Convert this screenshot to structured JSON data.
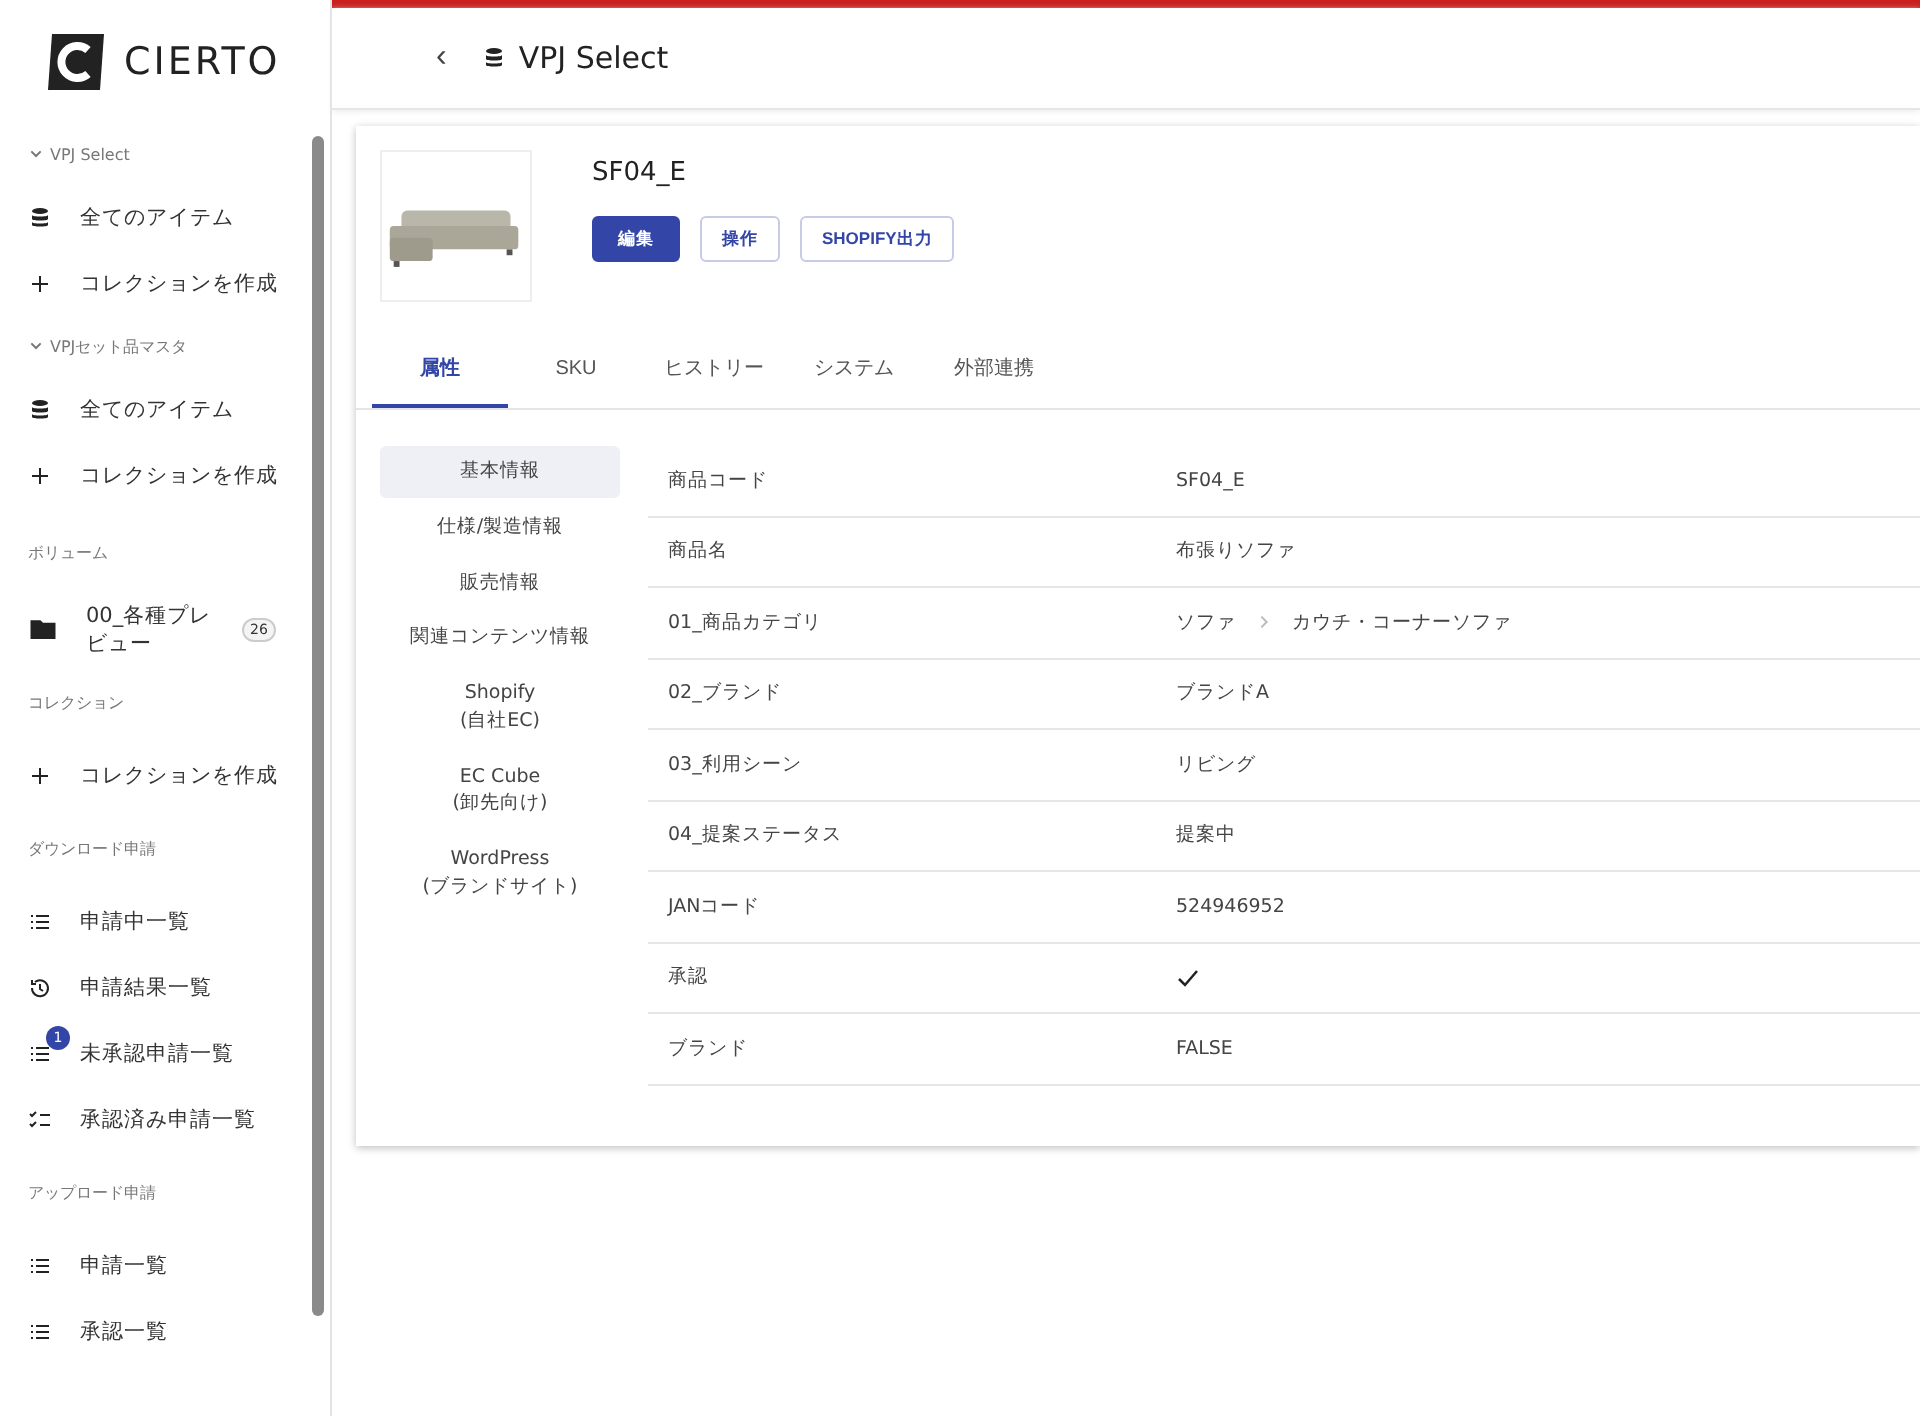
{
  "logo": {
    "text": "CIERTO"
  },
  "sidebar": {
    "groups": [
      {
        "heading": "VPJ Select",
        "collapsible": true,
        "items": [
          {
            "label": "全てのアイテム",
            "kind": "database"
          },
          {
            "label": "コレクションを作成",
            "kind": "plus"
          }
        ]
      },
      {
        "heading": "VPJセット品マスタ",
        "collapsible": true,
        "items": [
          {
            "label": "全てのアイテム",
            "kind": "database"
          },
          {
            "label": "コレクションを作成",
            "kind": "plus"
          }
        ]
      },
      {
        "heading": "ボリューム",
        "collapsible": false,
        "items": [
          {
            "label": "00_各種プレビュー",
            "kind": "folder",
            "count": "26"
          }
        ]
      },
      {
        "heading": "コレクション",
        "collapsible": false,
        "items": [
          {
            "label": "コレクションを作成",
            "kind": "plus"
          }
        ]
      },
      {
        "heading": "ダウンロード申請",
        "collapsible": false,
        "items": [
          {
            "label": "申請中一覧",
            "kind": "list"
          },
          {
            "label": "申請結果一覧",
            "kind": "history"
          },
          {
            "label": "未承認申請一覧",
            "kind": "list",
            "badge": "1"
          },
          {
            "label": "承認済み申請一覧",
            "kind": "checklist"
          }
        ]
      },
      {
        "heading": "アップロード申請",
        "collapsible": false,
        "items": [
          {
            "label": "申請一覧",
            "kind": "list"
          },
          {
            "label": "承認一覧",
            "kind": "list"
          }
        ]
      }
    ]
  },
  "header": {
    "back": "‹",
    "title": "VPJ Select"
  },
  "product": {
    "kind": "picture",
    "code": "SF04_E",
    "buttons": [
      {
        "label": "編集",
        "kind": "primary"
      },
      {
        "label": "操作",
        "kind": "outlined"
      },
      {
        "label": "SHOPIFY出力",
        "kind": "outlined"
      }
    ]
  },
  "tabs": [
    {
      "label": "属性",
      "selected": true
    },
    {
      "label": "SKU",
      "selected": false
    },
    {
      "label": "ヒストリー",
      "selected": false
    },
    {
      "label": "システム",
      "selected": false
    },
    {
      "label": "外部連携",
      "selected": false
    }
  ],
  "sections": [
    {
      "label": "基本情報",
      "selected": true
    },
    {
      "label": "仕様/製造情報",
      "selected": false
    },
    {
      "label": "販売情報",
      "selected": false
    },
    {
      "label": "関連コンテンツ情報",
      "selected": false
    },
    {
      "label": "Shopify\n(自社EC)",
      "selected": false
    },
    {
      "label": "EC Cube\n(卸先向け)",
      "selected": false
    },
    {
      "label": "WordPress\n(ブランドサイト)",
      "selected": false
    }
  ],
  "attributes": [
    {
      "name": "商品コード",
      "kind": "text",
      "value": "SF04_E"
    },
    {
      "name": "商品名",
      "kind": "text",
      "value": "布張りソファ"
    },
    {
      "name": "01_商品カテゴリ",
      "kind": "path",
      "parts": [
        "ソファ",
        "カウチ・コーナーソファ"
      ]
    },
    {
      "name": "02_ブランド",
      "kind": "text",
      "value": "ブランドA"
    },
    {
      "name": "03_利用シーン",
      "kind": "text",
      "value": "リビング"
    },
    {
      "name": "04_提案ステータス",
      "kind": "text",
      "value": "提案中"
    },
    {
      "name": "JANコード",
      "kind": "text",
      "value": "524946952"
    },
    {
      "name": "承認",
      "kind": "check",
      "checked": true
    },
    {
      "name": "ブランド",
      "kind": "text",
      "value": "FALSE"
    }
  ]
}
